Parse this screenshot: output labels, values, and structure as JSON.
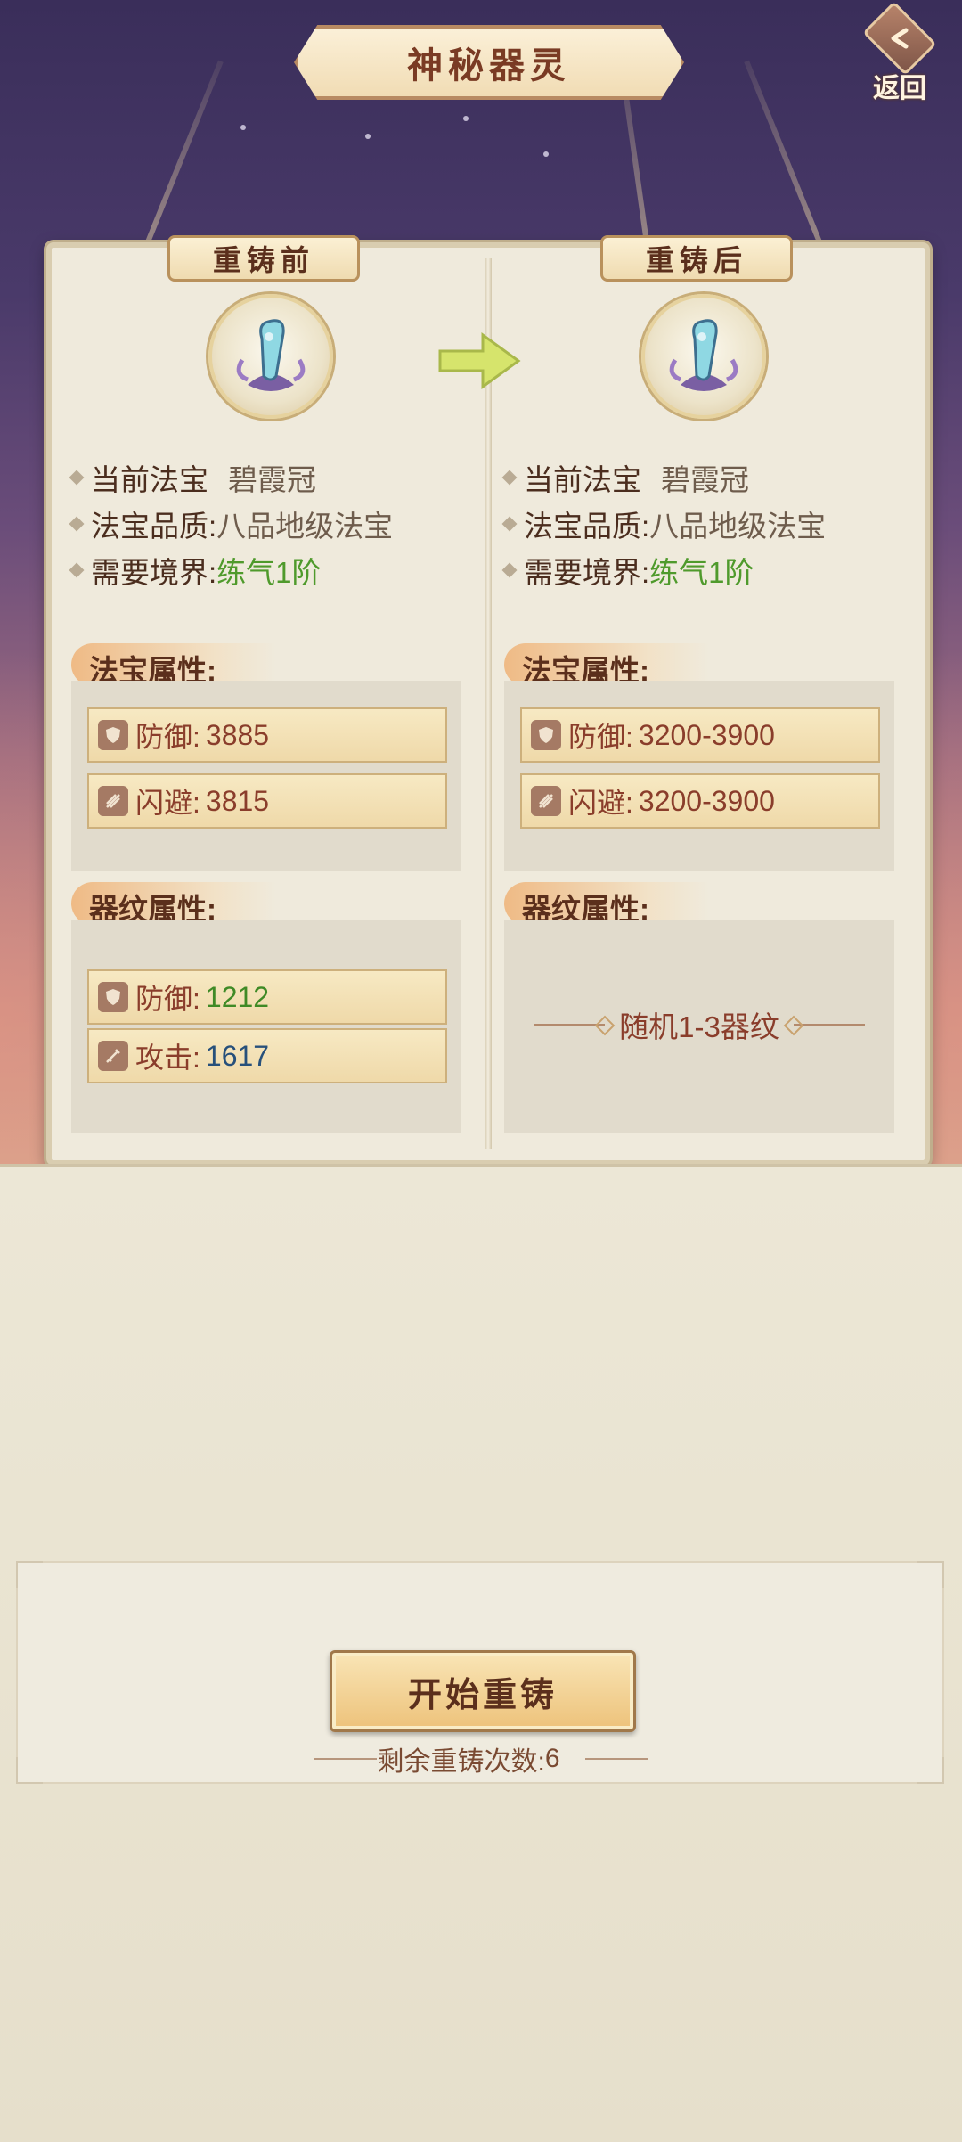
{
  "header": {
    "title": "神秘器灵",
    "back_label": "返回"
  },
  "before": {
    "tag": "重铸前",
    "info": [
      {
        "key": "当前法宝",
        "value": "碧霞冠"
      },
      {
        "key": "法宝品质:",
        "value": "八品地级法宝"
      },
      {
        "key": "需要境界:",
        "value": "练气1阶"
      }
    ],
    "treasure_section": "法宝属性:",
    "treasure_attrs": [
      {
        "name": "防御:",
        "value": "3885",
        "icon": "shield-icon"
      },
      {
        "name": "闪避:",
        "value": "3815",
        "icon": "dodge-icon"
      }
    ],
    "rune_section": "器纹属性:",
    "rune_attrs": [
      {
        "name": "防御:",
        "value": "1212",
        "icon": "shield-icon"
      },
      {
        "name": "攻击:",
        "value": "1617",
        "icon": "sword-icon"
      }
    ]
  },
  "after": {
    "tag": "重铸后",
    "info": [
      {
        "key": "当前法宝",
        "value": "碧霞冠"
      },
      {
        "key": "法宝品质:",
        "value": "八品地级法宝"
      },
      {
        "key": "需要境界:",
        "value": "练气1阶"
      }
    ],
    "treasure_section": "法宝属性:",
    "treasure_attrs": [
      {
        "name": "防御:",
        "value": "3200-3900",
        "icon": "shield-icon"
      },
      {
        "name": "闪避:",
        "value": "3200-3900",
        "icon": "dodge-icon"
      }
    ],
    "rune_section": "器纹属性:",
    "rune_random": "随机1-3器纹"
  },
  "colors": {
    "accent_text": "#8a3d2b",
    "realm_green": "#4f9a2c",
    "rune_defense": "#3f8a26",
    "rune_attack": "#27507b"
  },
  "footer": {
    "start_button": "开始重铸",
    "remaining_label": "剩余重铸次数:",
    "remaining_count": "6"
  }
}
